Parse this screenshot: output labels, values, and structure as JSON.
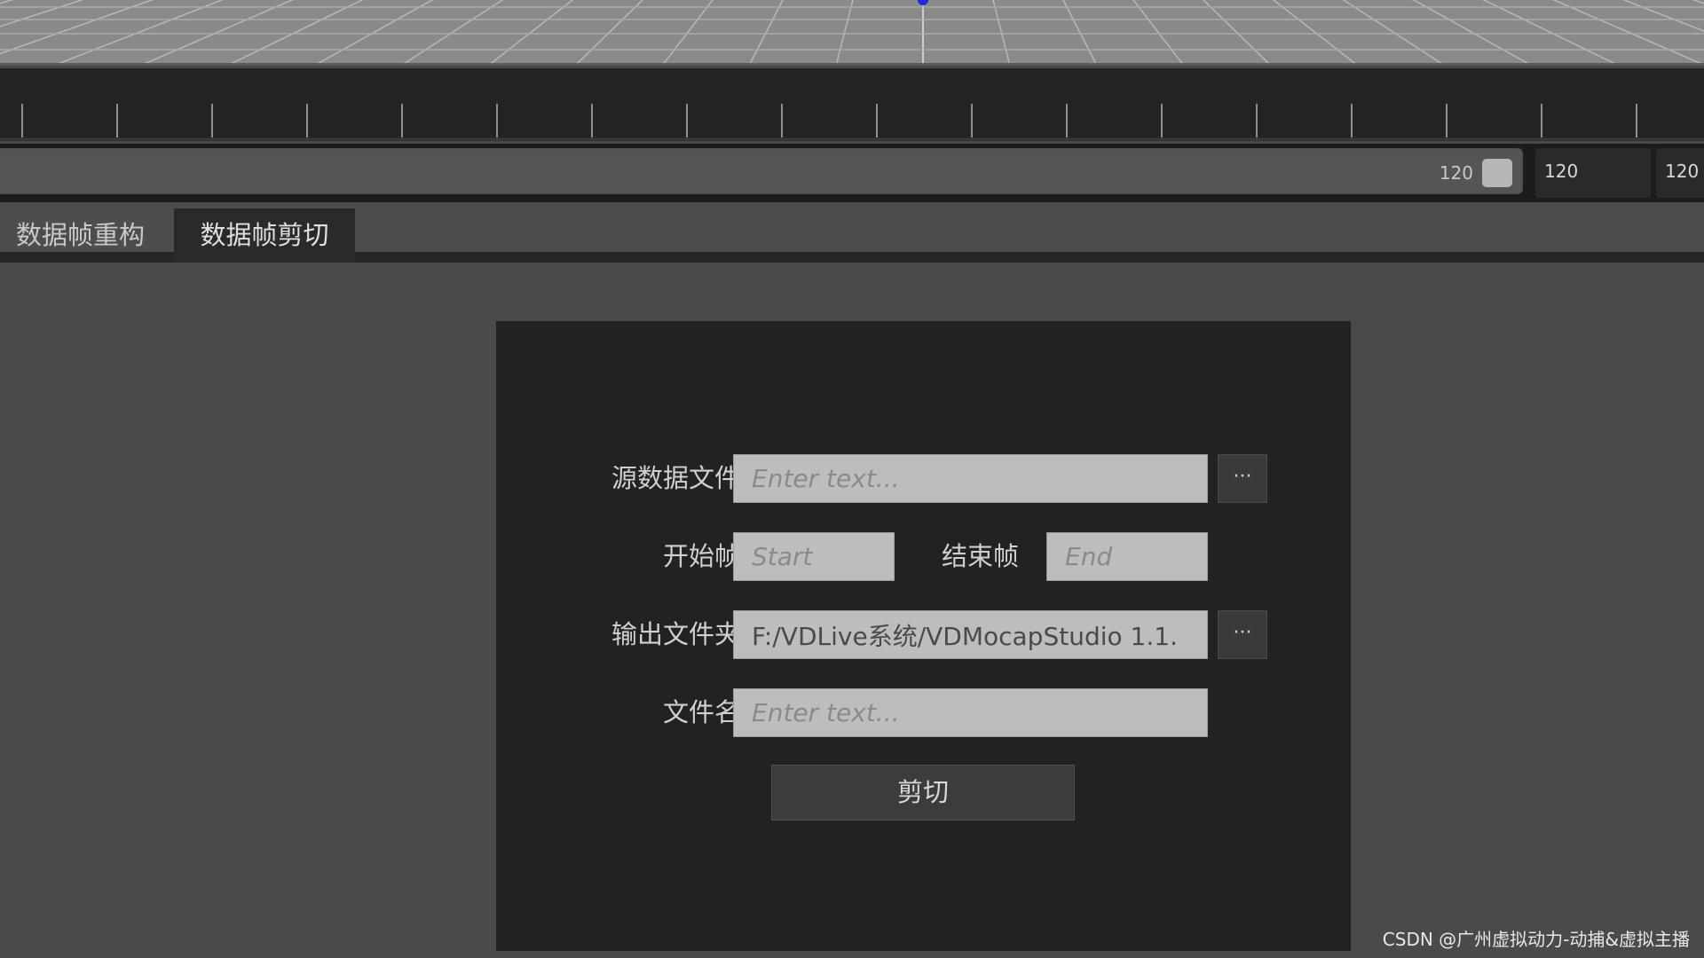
{
  "timeline": {
    "range_end_value": "120",
    "end_frame_a": "120",
    "end_frame_b": "120"
  },
  "tabs": [
    {
      "label": "数据帧重构"
    },
    {
      "label": "数据帧剪切"
    }
  ],
  "form": {
    "source_file": {
      "label": "源数据文件",
      "placeholder": "Enter text...",
      "browse_label": "···"
    },
    "start_frame": {
      "label": "开始帧",
      "placeholder": "Start"
    },
    "end_frame": {
      "label": "结束帧",
      "placeholder": "End"
    },
    "output_folder": {
      "label": "输出文件夹",
      "value": "F:/VDLive系统/VDMocapStudio 1.1.",
      "browse_label": "···"
    },
    "file_name": {
      "label": "文件名",
      "placeholder": "Enter text..."
    },
    "cut_button": "剪切"
  },
  "watermark": "CSDN @广州虚拟动力-动捕&虚拟主播",
  "colors": {
    "panel_bg": "#222222",
    "field_bg": "#bdbdbd",
    "active_tab_bg": "#2a2a2a"
  }
}
